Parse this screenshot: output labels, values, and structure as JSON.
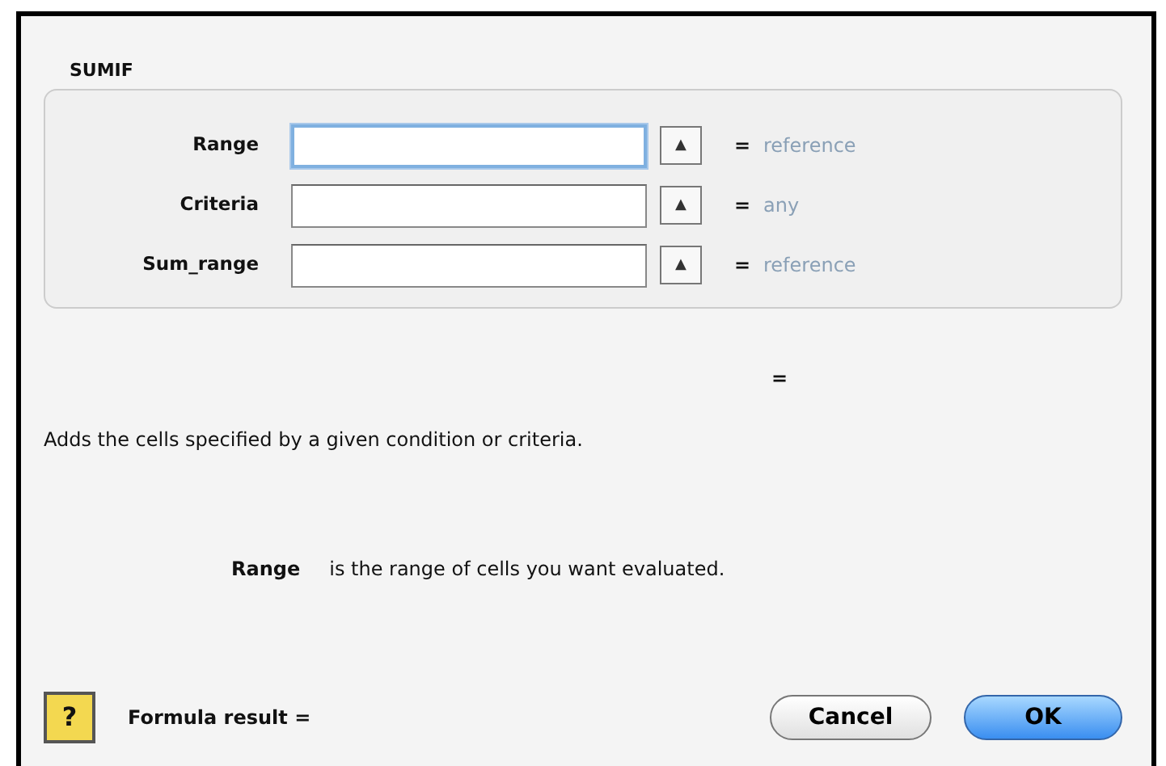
{
  "group": {
    "title": "SUMIF"
  },
  "arguments": [
    {
      "label": "Range",
      "focused": true,
      "collapse_button": "▲",
      "equals": "=",
      "result": "reference"
    },
    {
      "label": "Criteria",
      "focused": false,
      "collapse_button": "▲",
      "equals": "=",
      "result": "any"
    },
    {
      "label": "Sum_range",
      "focused": false,
      "collapse_button": "▲",
      "equals": "=",
      "result": "reference"
    }
  ],
  "value_equals": "=",
  "description": "Adds the cells specified by a given condition or criteria.",
  "argument_help": {
    "name": "Range",
    "text": "is the range of cells you want evaluated."
  },
  "footer": {
    "help_button": "?",
    "formula_result": "Formula result ="
  },
  "buttons": [
    {
      "label": "Cancel",
      "default": false
    },
    {
      "label": "OK",
      "default": true
    }
  ]
}
